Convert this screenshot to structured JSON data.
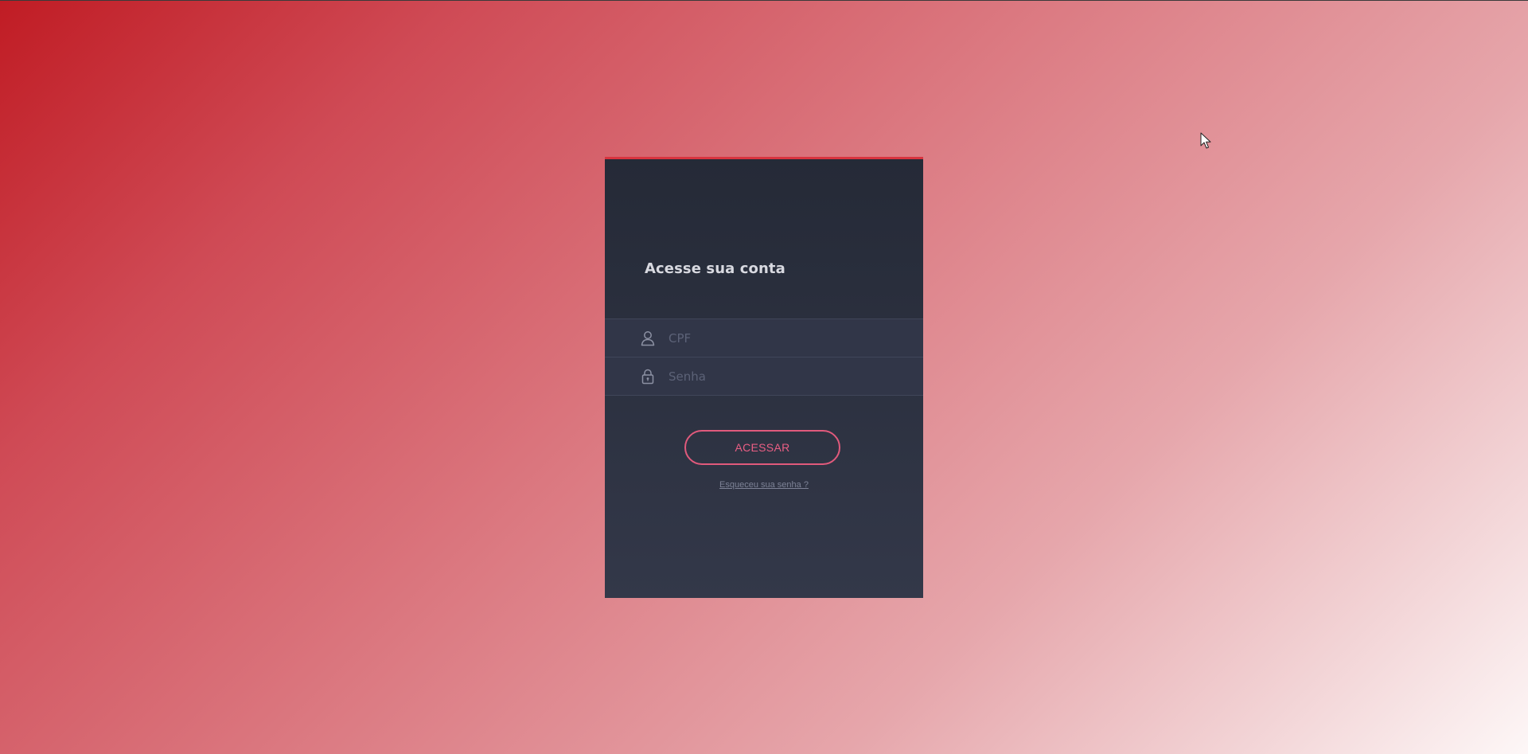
{
  "login": {
    "title": "Acesse sua conta",
    "cpf": {
      "placeholder": "CPF",
      "value": "",
      "icon": "user-icon"
    },
    "senha": {
      "placeholder": "Senha",
      "value": "",
      "icon": "lock-icon"
    },
    "submit_label": "ACESSAR",
    "forgot_label": "Esqueceu sua senha ?"
  },
  "colors": {
    "background_start": "#c01c24",
    "background_end": "#fdf7f7",
    "card_top": "#252a37",
    "card_bottom": "#333849",
    "accent": "#d8343f",
    "button": "#e15a7c"
  }
}
